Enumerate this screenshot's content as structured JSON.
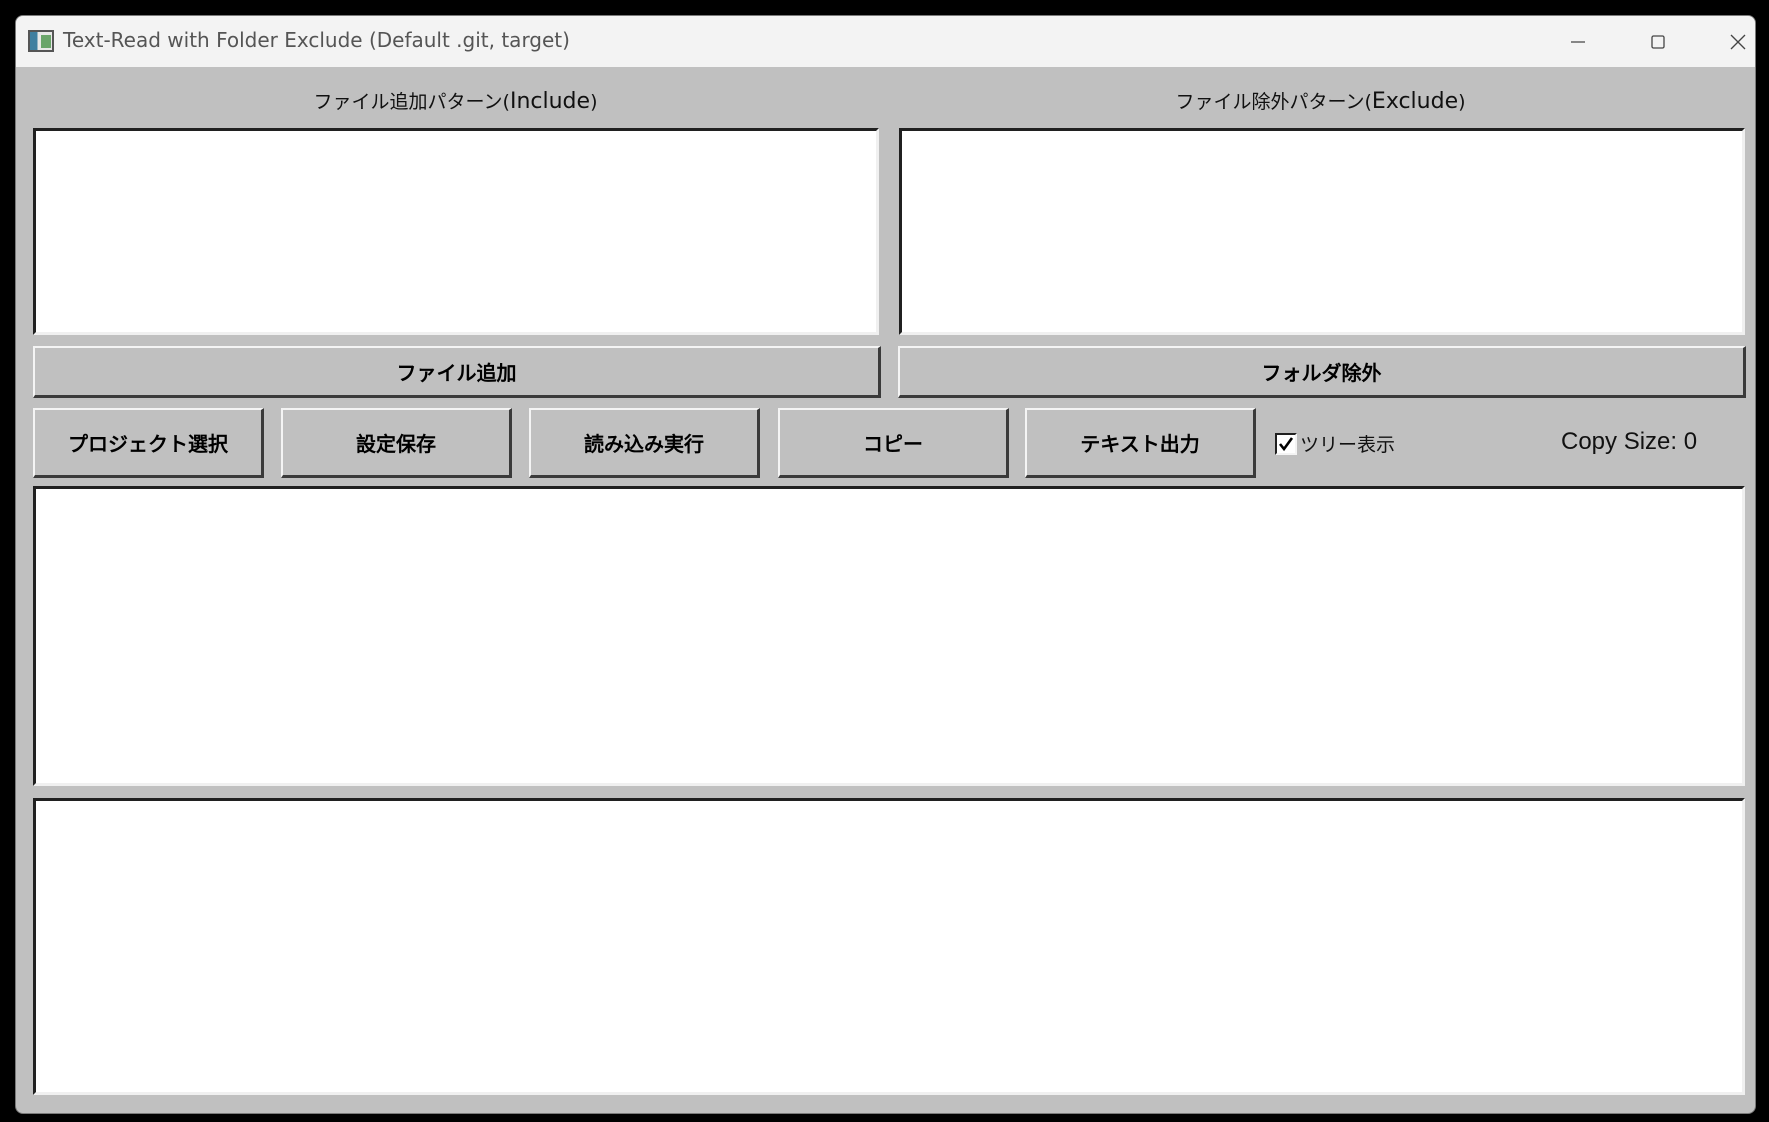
{
  "window": {
    "title": "Text-Read with Folder Exclude (Default .git, target)"
  },
  "include_panel": {
    "label_jp": "ファイル追加パターン(",
    "label_en": "Include",
    "label_close": ")",
    "value": "",
    "button_label": "ファイル追加"
  },
  "exclude_panel": {
    "label_jp": "ファイル除外パターン(",
    "label_en": "Exclude",
    "label_close": ")",
    "value": "",
    "button_label": "フォルダ除外"
  },
  "toolbar": {
    "project_label": "プロジェクト選択",
    "save_label": "設定保存",
    "read_label": "読み込み実行",
    "copy_label": "コピー",
    "export_label": "テキスト出力",
    "tree_label": "ツリー表示",
    "tree_checked": true,
    "copy_size_label": "Copy Size: 0"
  },
  "file_list": {
    "value": ""
  },
  "output": {
    "value": ""
  },
  "colors": {
    "window_bg": "#c0c0c0",
    "titlebar_bg": "#f3f3f3",
    "field_bg": "#ffffff"
  },
  "icons": {
    "app": "app-icon",
    "minimize": "minimize-icon",
    "maximize": "maximize-icon",
    "close": "close-icon",
    "check": "checkmark-icon"
  }
}
